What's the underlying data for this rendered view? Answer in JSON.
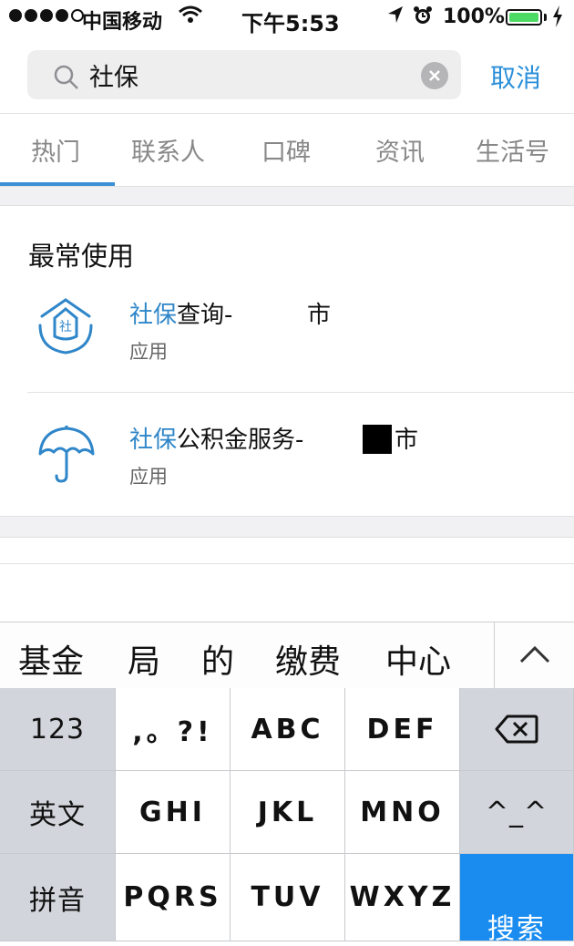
{
  "status_bar": {
    "carrier": "中国移动",
    "time": "下午5:53",
    "battery": "100%",
    "signal_dots": [
      "full",
      "full",
      "full",
      "full",
      "empty"
    ]
  },
  "search": {
    "query": "社保",
    "cancel_label": "取消",
    "icons": [
      "search-icon",
      "clear-icon"
    ]
  },
  "tabs": [
    {
      "label": "热门",
      "active": true
    },
    {
      "label": "联系人",
      "active": false
    },
    {
      "label": "口碑",
      "active": false
    },
    {
      "label": "资讯",
      "active": false
    },
    {
      "label": "生活号",
      "active": false
    }
  ],
  "section": {
    "title": "最常使用",
    "items": [
      {
        "highlight": "社保",
        "rest_before": "查询-",
        "rest_after": "市",
        "subtitle": "应用",
        "icon": "house-shield-icon"
      },
      {
        "highlight": "社保",
        "rest_before": "公积金服务-",
        "rest_after": "市",
        "subtitle": "应用",
        "icon": "umbrella-icon"
      }
    ]
  },
  "keyboard": {
    "candidates": [
      "基金",
      "局",
      "的",
      "缴费",
      "中心"
    ],
    "rows": [
      [
        "123",
        ",。?!",
        "ABC",
        "DEF",
        "⌫"
      ],
      [
        "英文",
        "GHI",
        "JKL",
        "MNO",
        "^_^"
      ],
      [
        "拼音",
        "PQRS",
        "TUV",
        "WXYZ",
        "搜索"
      ]
    ]
  },
  "colors": {
    "accent": "#2a8fd9",
    "highlight": "#2f86c9",
    "tab_indicator": "#3b8fd6",
    "search_key": "#1a8cf0",
    "battery": "#4cd964"
  }
}
